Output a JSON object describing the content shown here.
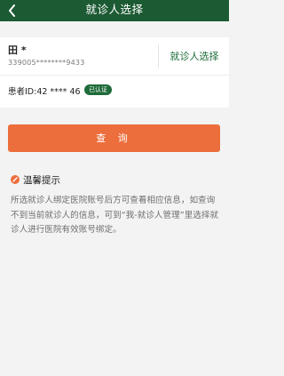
{
  "header": {
    "title": "就诊人选择",
    "background_color": "#1c5a33"
  },
  "patient": {
    "name": "田 *",
    "id_card": "339005********9433",
    "select_button_label": "就诊人选择",
    "patient_id_label": "患者ID:42 **** 46",
    "verified_label": "已认证"
  },
  "actions": {
    "query_label": "查 询",
    "query_color": "#ec6e3c"
  },
  "tip": {
    "title": "温馨提示",
    "content": "所选就诊人绑定医院账号后方可查看相应信息，如查询 不到当前就诊人的信息，可到“我-就诊人管理”里选择就诊人进行医院有效账号绑定。"
  }
}
